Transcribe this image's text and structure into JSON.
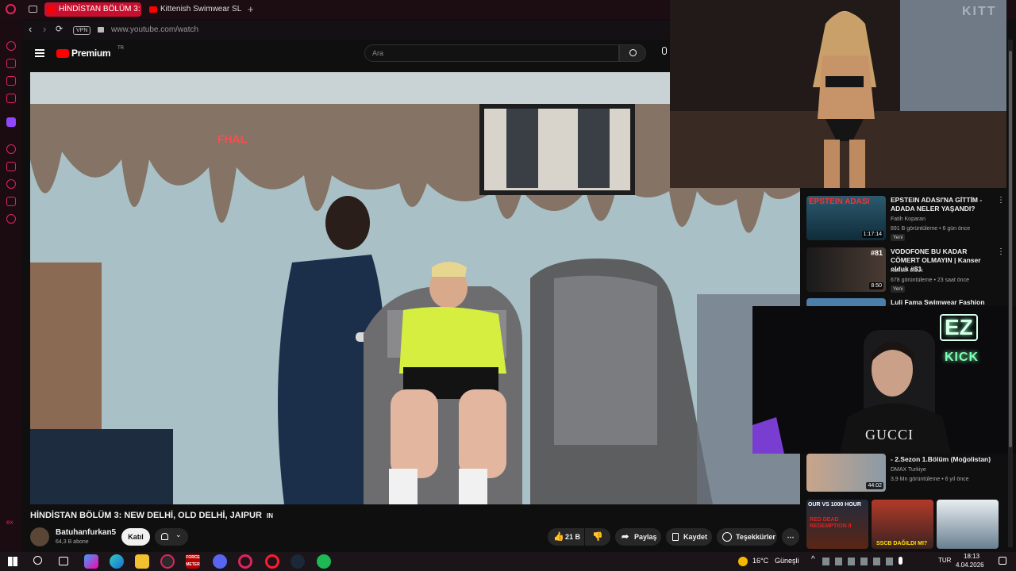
{
  "browser": {
    "tabs": [
      {
        "label": "HİNDİSTAN BÖLÜM 3:"
      },
      {
        "label": "Kittenish Swimwear SLOW"
      }
    ],
    "url": "www.youtube.com/watch",
    "vpn_label": "VPN"
  },
  "youtube": {
    "logo": "Premium",
    "logo_suffix": "TR",
    "search_placeholder": "Ara",
    "video": {
      "title": "HİNDİSTAN BÖLÜM 3: NEW DELHİ, OLD DELHİ, JAIPUR",
      "title_flag": "IN",
      "channel": "Batuhanfurkan5",
      "subscribers": "64,3 B abone",
      "join_label": "Katıl",
      "likes": "21 B",
      "share_label": "Paylaş",
      "save_label": "Kaydet",
      "thanks_label": "Teşekkürler"
    },
    "recommendations": [
      {
        "title": "EPSTEIN ADASI'NA GİTTİM - ADADA NELER YAŞANDI?",
        "channel": "Fatih Koparan",
        "meta": "891 B görüntüleme • 6 gün önce",
        "badge": "Yeni",
        "duration": "1:17:14",
        "thumb_text": "EPSTEIN ADASI"
      },
      {
        "title": "VODOFONE BU KADAR CÖMERT OLMAYIN | Kanser olduk #81",
        "channel": "Kanser olduk",
        "meta": "678 görüntüleme • 23 saat önce",
        "badge": "Yeni",
        "duration": "8:50",
        "thumb_text": "#81"
      },
      {
        "title": "Luli Fama Swimwear Fashion",
        "channel": "",
        "meta": "",
        "badge": "",
        "duration": "",
        "thumb_text": ""
      },
      {
        "title": "- 2.Sezon 1.Bölüm (Moğolistan)",
        "channel": "DMAX Turkiye",
        "meta": "3,9 Mn görüntüleme • 6 yıl önce",
        "badge": "",
        "duration": "44:02",
        "thumb_text": ""
      }
    ],
    "shorts": [
      {
        "text": "OUR VS 1000 HOUR",
        "sub": "RED DEAD REDEMPTION II"
      },
      {
        "text": "SSCB DAĞILDI MI?"
      },
      {
        "text": ""
      }
    ]
  },
  "overlays": {
    "cam_sign_top": "EZ",
    "cam_sign_bottom": "KICK",
    "shirt_text": "GUCCI",
    "pip_sign": "KITT",
    "video_sign": "FHAL"
  },
  "taskbar": {
    "weather": "16°C",
    "weather_desc": "Güneşli",
    "lang": "TUR",
    "time": "18:13",
    "date": "4.04.2026",
    "app_label": "FORCE METER"
  },
  "colors": {
    "accent_red": "#ff0000",
    "opera_red": "#e0245e",
    "neon_green": "#7dffb2"
  }
}
